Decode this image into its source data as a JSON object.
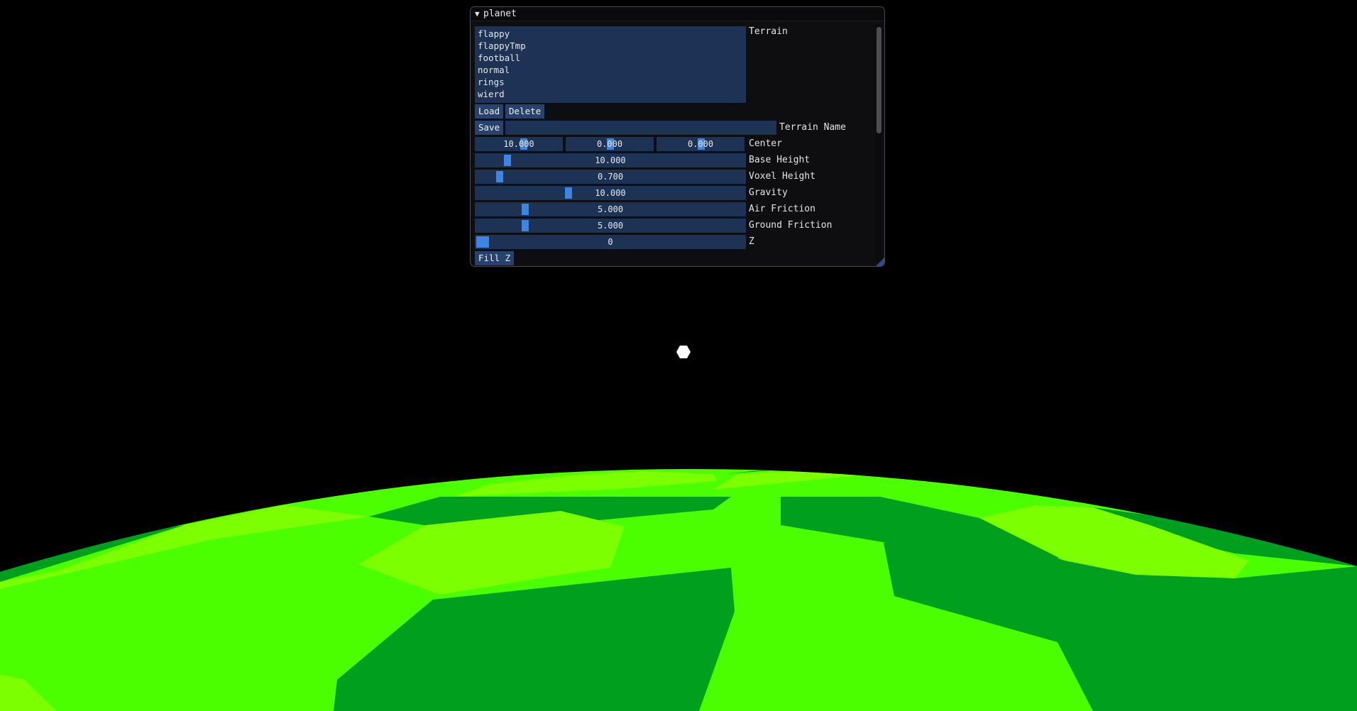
{
  "window": {
    "title": "planet",
    "terrain_label": "Terrain",
    "terrain_list": [
      "flappy",
      "flappyTmp",
      "football",
      "normal",
      "rings",
      "wierd"
    ],
    "load_button": "Load",
    "delete_button": "Delete",
    "save_button": "Save",
    "terrain_name_value": "",
    "terrain_name_label": "Terrain Name",
    "center": {
      "label": "Center",
      "x": "10.000",
      "y": "0.000",
      "z": "0.000"
    },
    "base_height": {
      "label": "Base Height",
      "value": "10.000",
      "slider_fraction": 0.105
    },
    "voxel_height": {
      "label": "Voxel Height",
      "value": "0.700",
      "slider_fraction": 0.075
    },
    "gravity": {
      "label": "Gravity",
      "value": "10.000",
      "slider_fraction": 0.34
    },
    "air_friction": {
      "label": "Air Friction",
      "value": "5.000",
      "slider_fraction": 0.175
    },
    "ground_friction": {
      "label": "Ground Friction",
      "value": "5.000",
      "slider_fraction": 0.175
    },
    "z": {
      "label": "Z",
      "value": "0",
      "slider_fraction": 0.0
    },
    "fill_z_button": "Fill Z"
  },
  "colors": {
    "bright_green": "#7cff00",
    "mid_green": "#4cff00",
    "dark_green": "#00a01e",
    "slider_grab": "#3d85e0",
    "frame_bg": "#1d3355",
    "button_bg": "#26426d"
  }
}
